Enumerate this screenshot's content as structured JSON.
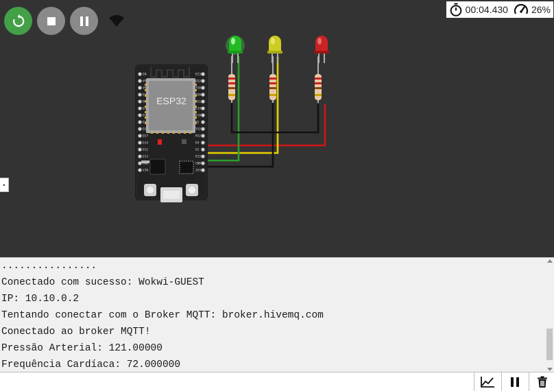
{
  "controls": {
    "restart": "restart-icon",
    "stop": "stop-icon",
    "pause": "pause-icon",
    "wifi": "wifi-icon"
  },
  "stats": {
    "timer": "00:04.430",
    "speed": "26%"
  },
  "board": {
    "chip_label": "ESP32",
    "left_pins": [
      "EN",
      "VP",
      "VN",
      "D34",
      "D35",
      "D32",
      "D33",
      "D25",
      "D26",
      "D27",
      "D14",
      "D12",
      "D13",
      "GND",
      "VIN"
    ],
    "right_pins": [
      "D23",
      "D22",
      "TX0",
      "RX0",
      "D21",
      "D19",
      "D18",
      "D5",
      "TX2",
      "RX2",
      "D4",
      "D2",
      "D15",
      "GND",
      "3V3"
    ]
  },
  "leds": [
    {
      "color": "#22bb22",
      "lit": true
    },
    {
      "color": "#cccc22",
      "lit": false
    },
    {
      "color": "#cc2222",
      "lit": false
    }
  ],
  "wire_colors": {
    "green": "#2aa02a",
    "yellow": "#e6d200",
    "red": "#d01515",
    "black": "#111111"
  },
  "serial": {
    "lines": [
      "................",
      "Conectado com sucesso: Wokwi-GUEST",
      "IP: 10.10.0.2",
      "Tentando conectar com o Broker MQTT: broker.hivemq.com",
      "Conectado ao broker MQTT!",
      "Pressão Arterial: 121.00000",
      "Frequência Cardíaca: 72.000000"
    ],
    "input_placeholder": ""
  },
  "toolbar": {
    "plot": "chart-icon",
    "pause": "pause-icon",
    "clear": "trash-icon"
  }
}
